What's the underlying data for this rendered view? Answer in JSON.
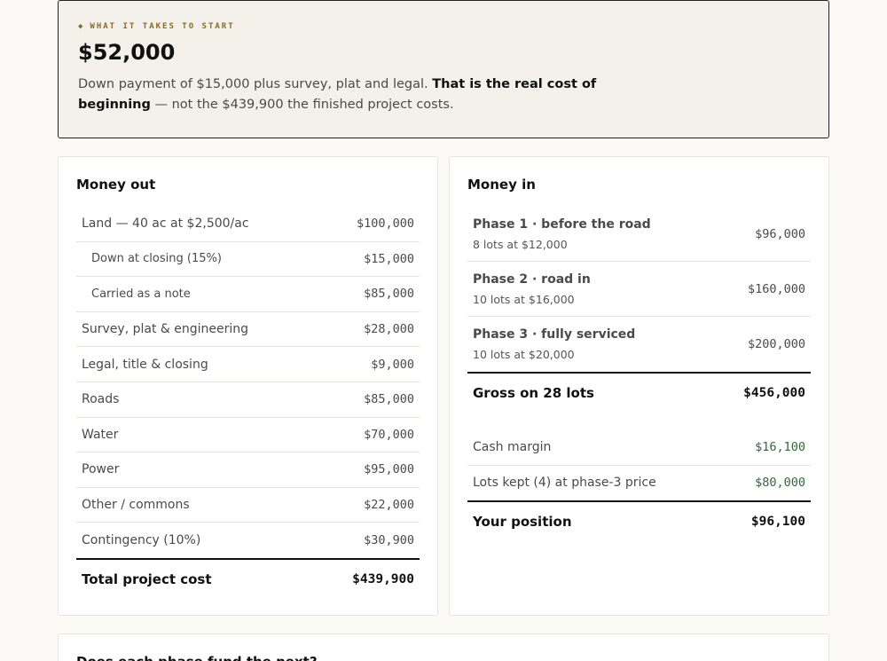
{
  "start": {
    "eyebrow": "What it takes to start",
    "eyebrow_icon": "diamond-bullet",
    "amount": "$52,000",
    "desc_plain_1": "Down payment of $15,000 plus survey, plat and legal. ",
    "desc_bold": "That is the real cost of beginning",
    "desc_plain_2": " — not the $439,900 the finished project costs."
  },
  "money_out": {
    "title": "Money out",
    "rows": [
      {
        "label": "Land — 40 ac at $2,500/ac",
        "value": "$100,000"
      },
      {
        "label": "Down at closing (15%)",
        "value": "$15,000"
      },
      {
        "label": "Carried as a note",
        "value": "$85,000"
      },
      {
        "label": "Survey, plat & engineering",
        "value": "$28,000"
      },
      {
        "label": "Legal, title & closing",
        "value": "$9,000"
      },
      {
        "label": "Roads",
        "value": "$85,000"
      },
      {
        "label": "Water",
        "value": "$70,000"
      },
      {
        "label": "Power",
        "value": "$95,000"
      },
      {
        "label": "Other / commons",
        "value": "$22,000"
      },
      {
        "label": "Contingency (10%)",
        "value": "$30,900"
      }
    ],
    "total_label": "Total project cost",
    "total_value": "$439,900"
  },
  "money_in": {
    "title": "Money in",
    "phases": [
      {
        "name": "Phase 1 · before the road",
        "detail": "8 lots at $12,000",
        "value": "$96,000"
      },
      {
        "name": "Phase 2 · road in",
        "detail": "10 lots at $16,000",
        "value": "$160,000"
      },
      {
        "name": "Phase 3 · fully serviced",
        "detail": "10 lots at $20,000",
        "value": "$200,000"
      }
    ],
    "gross_label": "Gross on 28 lots",
    "gross_value": "$456,000",
    "extras": [
      {
        "label": "Cash margin",
        "value": "$16,100"
      },
      {
        "label": "Lots kept (4) at phase-3 price",
        "value": "$80,000"
      }
    ],
    "position_label": "Your position",
    "position_value": "$96,100"
  },
  "bottom": {
    "title": "Does each phase fund the next?"
  },
  "colors": {
    "accent": "#8a6a2a",
    "positive": "#2f6b3a",
    "background": "#fbfaf6",
    "start_box": "#f3f1e9"
  }
}
